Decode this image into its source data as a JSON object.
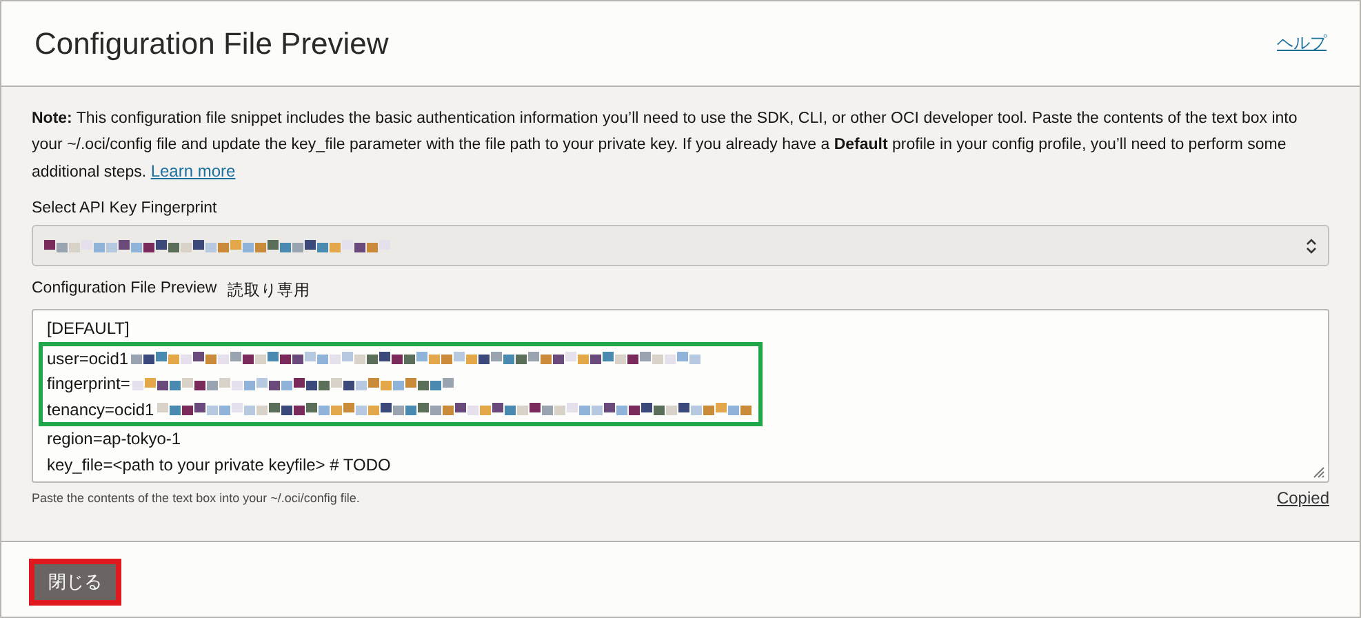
{
  "header": {
    "title": "Configuration File Preview",
    "help_link": "ヘルプ"
  },
  "note": "**Note:** This configuration file snippet includes the basic authentication information you’ll need to use the SDK, CLI, or other OCI developer tool. Paste the contents of the text box into your ~/.oci/config file and update the key_file parameter with the file path to your private key. If you already have a **Default** profile in your config profile, you’ll need to perform some additional steps.",
  "learn_more": "Learn more",
  "fingerprint_select": {
    "label": "Select API Key Fingerprint",
    "redacted": true
  },
  "preview": {
    "label": "Configuration File Preview",
    "badge": "読取り専用",
    "lines": [
      {
        "text": "[DEFAULT]",
        "redacted": false,
        "highlighted": false
      },
      {
        "text": "user=ocid1",
        "redacted": true,
        "highlighted": true
      },
      {
        "text": "fingerprint=",
        "redacted": true,
        "highlighted": true
      },
      {
        "text": "tenancy=ocid1",
        "redacted": true,
        "highlighted": true
      },
      {
        "text": "region=ap-tokyo-1",
        "redacted": false,
        "highlighted": false
      },
      {
        "text": "key_file=<path to your private keyfile> # TODO",
        "redacted": false,
        "highlighted": false
      }
    ],
    "hint": "Paste the contents of the text box into your ~/.oci/config file.",
    "copied_link": "Copied"
  },
  "footer": {
    "close_button": "閉じる",
    "button_highlighted": true
  }
}
